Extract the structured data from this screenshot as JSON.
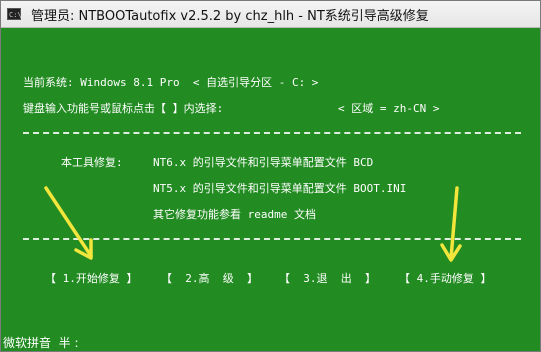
{
  "window": {
    "title": "管理员:  NTBOOTautofix v2.5.2 by chz_hlh - NT系统引导高级修复",
    "icon_label": "C:\\"
  },
  "status": {
    "current_system": "当前系统: Windows 8.1 Pro  < 自选引导分区 - C: >",
    "input_prompt": "键盘输入功能号或鼠标点击【 】内选择:",
    "locale": "< 区域 = zh-CN >"
  },
  "tools": {
    "label": "本工具修复:",
    "items": [
      "NT6.x 的引导文件和引导菜单配置文件 BCD",
      "NT5.x 的引导文件和引导菜单配置文件 BOOT.INI",
      "其它修复功能参看 readme 文档"
    ]
  },
  "menu": {
    "start": "【 1.开始修复 】",
    "advanced": "【  2.高  级  】",
    "exit": "【  3.退  出  】",
    "manual": "【 4.手动修复 】"
  },
  "ime": {
    "label": "微软拼音  半 :"
  },
  "colors": {
    "console_bg": "#228B22",
    "text": "#FFFFFF",
    "arrow": "#F2E53B"
  },
  "icons": [
    "cmd-icon",
    "arrow-icon"
  ]
}
